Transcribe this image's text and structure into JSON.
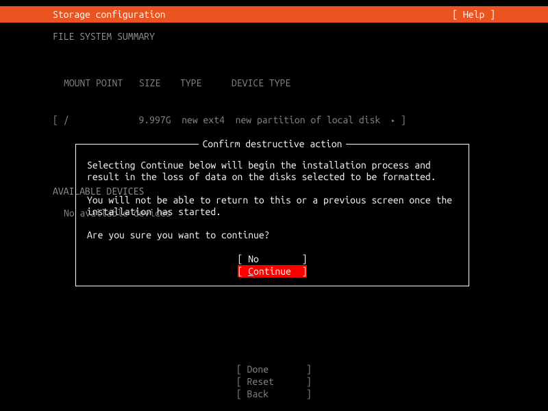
{
  "header": {
    "title": "Storage configuration",
    "help": "[ Help ]"
  },
  "sections": {
    "summary_header": "FILE SYSTEM SUMMARY",
    "columns": {
      "mount": "MOUNT POINT",
      "size": "SIZE",
      "type": "TYPE",
      "device": "DEVICE TYPE"
    },
    "row": {
      "open": "[",
      "mount": "/",
      "size": "9.997G",
      "type": "new ext4",
      "device": "new partition of local disk",
      "arrow": "▸",
      "close": "]"
    },
    "avail_header": "AVAILABLE DEVICES",
    "avail_none": "No available devices"
  },
  "dialog": {
    "title": " Confirm destructive action ",
    "para1": "Selecting Continue below will begin the installation process and result in the loss of data on the disks selected to be formatted.",
    "para2": "You will not be able to return to this or a previous screen once the installation has started.",
    "para3": "Are you sure you want to continue?",
    "btn_no_open": "[ ",
    "btn_no_label": "No",
    "btn_no_pad": "        ]",
    "btn_cont_open": "[ ",
    "btn_cont_ul": "C",
    "btn_cont_rest": "ontinue",
    "btn_cont_pad": "  ]"
  },
  "footer": {
    "done": "[ Done       ]",
    "reset": "[ Reset      ]",
    "back": "[ Back       ]"
  }
}
